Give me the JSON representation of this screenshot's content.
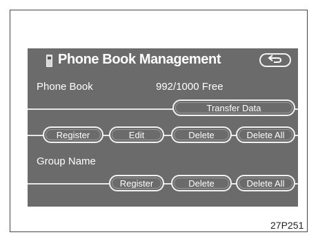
{
  "header": {
    "title": "Phone Book Management"
  },
  "phone_book": {
    "label": "Phone Book",
    "count": "992",
    "total": "/1000",
    "free": "Free",
    "transfer_label": "Transfer Data",
    "register_label": "Register",
    "edit_label": "Edit",
    "delete_label": "Delete",
    "delete_all_label": "Delete All"
  },
  "group": {
    "label": "Group Name",
    "register_label": "Register",
    "delete_label": "Delete",
    "delete_all_label": "Delete All"
  },
  "caption": "27P251",
  "icons": {
    "back": "back-arrow-icon",
    "phone": "phone-icon"
  }
}
